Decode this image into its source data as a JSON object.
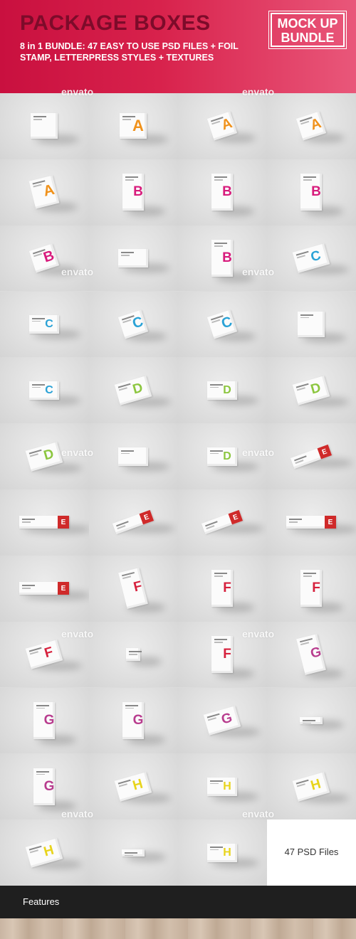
{
  "header": {
    "title": "PACKAGE BOXES",
    "subtitle": "8 in 1 BUNDLE: 47 EASY TO USE PSD FILES + FOIL STAMP, LETTERPRESS STYLES + TEXTURES",
    "badge_line1": "MOCK UP",
    "badge_line2": "BUNDLE",
    "accent_color": "#c9103f"
  },
  "watermark": "envato",
  "grid": {
    "rows": 12,
    "columns": 4,
    "cells": [
      {
        "letter": "",
        "color": "#e8971c",
        "style": "flat-square"
      },
      {
        "letter": "A",
        "color": "#f0921c",
        "style": "flat-square"
      },
      {
        "letter": "A",
        "color": "#f0921c",
        "style": "angled-cube"
      },
      {
        "letter": "A",
        "color": "#f0921c",
        "style": "angled-cube"
      },
      {
        "letter": "A",
        "color": "#f0921c",
        "style": "angled-tall"
      },
      {
        "letter": "B",
        "color": "#d81b7c",
        "style": "tall"
      },
      {
        "letter": "B",
        "color": "#d81b7c",
        "style": "tall"
      },
      {
        "letter": "B",
        "color": "#d81b7c",
        "style": "tall"
      },
      {
        "letter": "B",
        "color": "#d81b7c",
        "style": "angled-cube"
      },
      {
        "letter": "",
        "color": "#d81b7c",
        "style": "flat-wide"
      },
      {
        "letter": "B",
        "color": "#d81b7c",
        "style": "tall"
      },
      {
        "letter": "C",
        "color": "#2aa2d6",
        "style": "angled-wide"
      },
      {
        "letter": "C",
        "color": "#2aa2d6",
        "style": "flat-wide"
      },
      {
        "letter": "C",
        "color": "#2aa2d6",
        "style": "angled-cube"
      },
      {
        "letter": "C",
        "color": "#2aa2d6",
        "style": "angled-cube"
      },
      {
        "letter": "",
        "color": "#2aa2d6",
        "style": "flat-square"
      },
      {
        "letter": "C",
        "color": "#2aa2d6",
        "style": "flat-wide"
      },
      {
        "letter": "D",
        "color": "#8cc63f",
        "style": "angled-wide"
      },
      {
        "letter": "D",
        "color": "#8cc63f",
        "style": "flat-wide"
      },
      {
        "letter": "D",
        "color": "#8cc63f",
        "style": "angled-wide"
      },
      {
        "letter": "D",
        "color": "#8cc63f",
        "style": "angled-wide"
      },
      {
        "letter": "",
        "color": "#8cc63f",
        "style": "flat-wide"
      },
      {
        "letter": "D",
        "color": "#8cc63f",
        "style": "flat-wide"
      },
      {
        "letter": "E",
        "color": "#cf2a2a",
        "style": "long-angled"
      },
      {
        "letter": "E",
        "color": "#cf2a2a",
        "style": "long"
      },
      {
        "letter": "E",
        "color": "#cf2a2a",
        "style": "long-angled"
      },
      {
        "letter": "E",
        "color": "#cf2a2a",
        "style": "long-angled"
      },
      {
        "letter": "E",
        "color": "#cf2a2a",
        "style": "long"
      },
      {
        "letter": "E",
        "color": "#cf2a2a",
        "style": "long"
      },
      {
        "letter": "F",
        "color": "#d6203c",
        "style": "tall-angled"
      },
      {
        "letter": "F",
        "color": "#d6203c",
        "style": "tall"
      },
      {
        "letter": "F",
        "color": "#d6203c",
        "style": "tall"
      },
      {
        "letter": "F",
        "color": "#d6203c",
        "style": "angled-wide"
      },
      {
        "letter": "",
        "color": "#d6203c",
        "style": "small"
      },
      {
        "letter": "F",
        "color": "#d6203c",
        "style": "tall"
      },
      {
        "letter": "G",
        "color": "#b83c8e",
        "style": "tall-angled"
      },
      {
        "letter": "G",
        "color": "#b83c8e",
        "style": "tall"
      },
      {
        "letter": "G",
        "color": "#b83c8e",
        "style": "tall"
      },
      {
        "letter": "G",
        "color": "#b83c8e",
        "style": "angled-wide"
      },
      {
        "letter": "",
        "color": "#b83c8e",
        "style": "thin"
      },
      {
        "letter": "G",
        "color": "#b83c8e",
        "style": "tall"
      },
      {
        "letter": "H",
        "color": "#e8d41c",
        "style": "angled-wide"
      },
      {
        "letter": "H",
        "color": "#e8d41c",
        "style": "flat-wide"
      },
      {
        "letter": "H",
        "color": "#e8d41c",
        "style": "angled-wide"
      },
      {
        "letter": "H",
        "color": "#e8d41c",
        "style": "angled-wide"
      },
      {
        "letter": "",
        "color": "#e8d41c",
        "style": "thin"
      },
      {
        "letter": "H",
        "color": "#e8d41c",
        "style": "flat-wide"
      }
    ],
    "final_label": "47 PSD Files"
  },
  "footer": {
    "features_label": "Features"
  }
}
